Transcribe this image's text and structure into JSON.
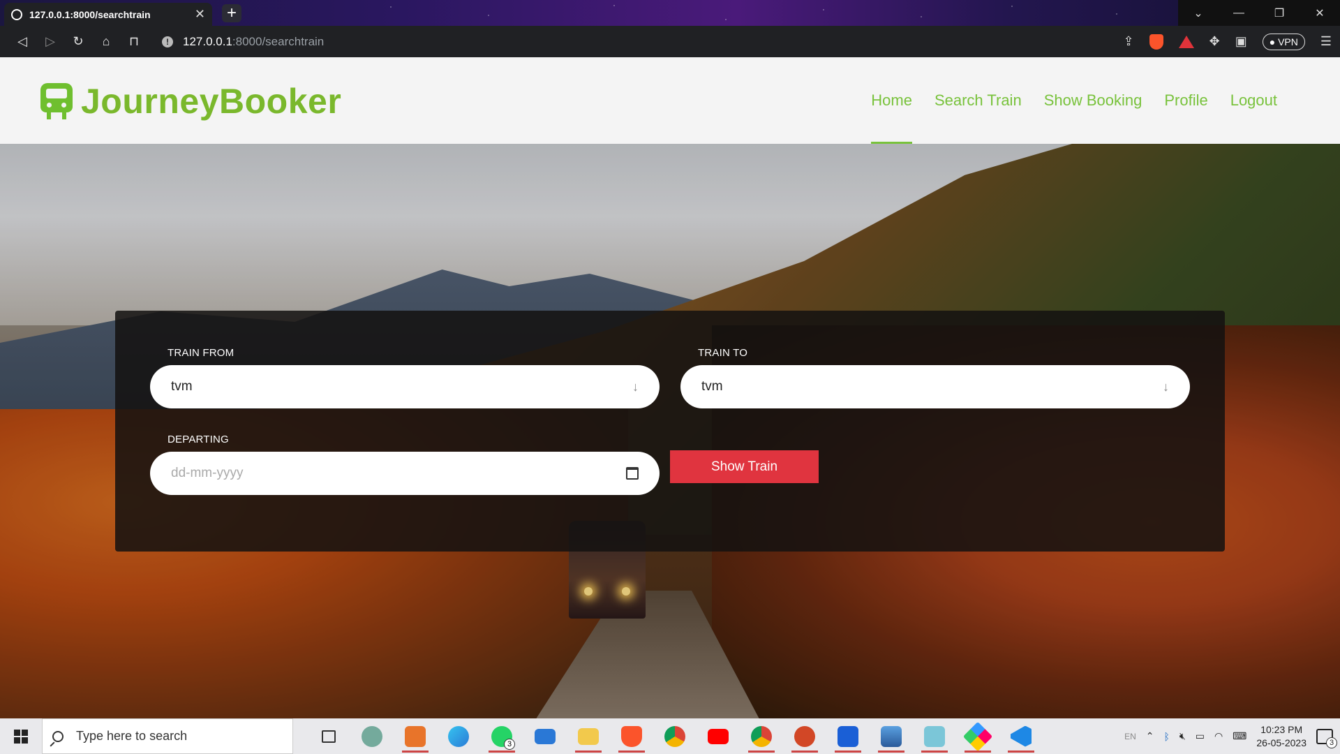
{
  "browser": {
    "tab_title": "127.0.0.1:8000/searchtrain",
    "new_tab": "+",
    "url_host": "127.0.0.1",
    "url_rest": ":8000/searchtrain",
    "vpn_label": "VPN",
    "window_controls": [
      "⌄",
      "—",
      "❐",
      "✕"
    ]
  },
  "site": {
    "brand": "JourneyBooker",
    "nav": [
      {
        "label": "Home",
        "active": true
      },
      {
        "label": "Search Train"
      },
      {
        "label": "Show Booking"
      },
      {
        "label": "Profile"
      },
      {
        "label": "Logout"
      }
    ]
  },
  "form": {
    "from_label": "TRAIN FROM",
    "from_value": "tvm",
    "to_label": "TRAIN TO",
    "to_value": "tvm",
    "departing_label": "DEPARTING",
    "departing_placeholder": "dd-mm-yyyy",
    "submit_label": "Show Train"
  },
  "taskbar": {
    "search_placeholder": "Type here to search",
    "whatsapp_badge": "3",
    "lang": "EN",
    "time": "10:23 PM",
    "date": "26-05-2023",
    "notifications_badge": "3"
  },
  "colors": {
    "brand_green": "#78c23b",
    "button_red": "#e0343f"
  }
}
